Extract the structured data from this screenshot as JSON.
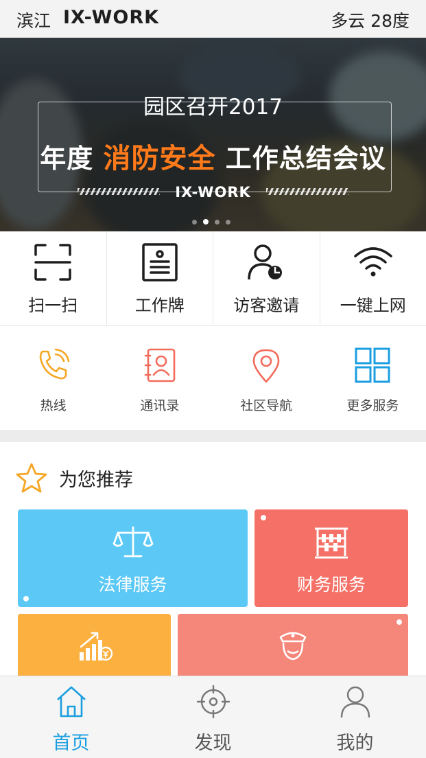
{
  "status": {
    "city": "滨江",
    "brand": "IX-WORK",
    "weather": "多云  28度"
  },
  "banner": {
    "line1": "园区召开2017",
    "line2_pre": "年度",
    "line2_highlight": "消防安全",
    "line2_post": "工作总结会议",
    "brand": "IX-WORK",
    "slide_count": 4,
    "active_slide": 1,
    "highlight_color": "#ff7a1a"
  },
  "quick_actions": [
    {
      "label": "扫一扫",
      "icon": "scan-icon"
    },
    {
      "label": "工作牌",
      "icon": "badge-icon"
    },
    {
      "label": "访客邀请",
      "icon": "visitor-icon"
    },
    {
      "label": "一键上网",
      "icon": "wifi-icon"
    }
  ],
  "services": [
    {
      "label": "热线",
      "icon": "phone-icon",
      "color": "#f5a623"
    },
    {
      "label": "通讯录",
      "icon": "contacts-icon",
      "color": "#f26b5b"
    },
    {
      "label": "社区导航",
      "icon": "location-pin-icon",
      "color": "#f26b5b"
    },
    {
      "label": "更多服务",
      "icon": "grid-icon",
      "color": "#1a9ee0"
    }
  ],
  "recommend": {
    "title": "为您推荐",
    "tiles": [
      {
        "label": "法律服务",
        "icon": "scales-icon",
        "color": "#5bc8f5"
      },
      {
        "label": "财务服务",
        "icon": "abacus-icon",
        "color": "#f57066"
      },
      {
        "label": "",
        "icon": "growth-chart-icon",
        "color": "#fbb040"
      },
      {
        "label": "",
        "icon": "security-guard-icon",
        "color": "#f5867a"
      }
    ]
  },
  "nav": {
    "items": [
      {
        "label": "首页",
        "icon": "home-icon",
        "active": true
      },
      {
        "label": "发现",
        "icon": "target-icon",
        "active": false
      },
      {
        "label": "我的",
        "icon": "user-icon",
        "active": false
      }
    ],
    "active_color": "#1a9ee0"
  }
}
